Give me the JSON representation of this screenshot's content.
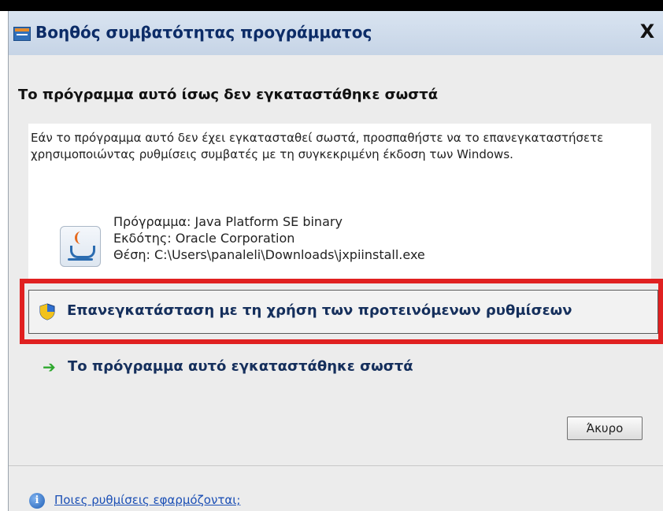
{
  "window": {
    "title": "Βοηθός συμβατότητας προγράμματος",
    "close_symbol": "X",
    "icon": "program-compatibility-icon"
  },
  "main": {
    "headline": "Το πρόγραμμα αυτό ίσως δεν εγκαταστάθηκε σωστά",
    "description": "Εάν το πρόγραμμα αυτό δεν έχει εγκατασταθεί σωστά, προσπαθήστε να το επανεγκαταστήσετε χρησιμοποιώντας ρυθμίσεις συμβατές με τη συγκεκριμένη έκδοση των Windows.",
    "program_icon": "java-icon",
    "program": "Πρόγραμμα: Java Platform SE binary",
    "publisher": "Εκδότης: Oracle Corporation",
    "location": "Θέση: C:\\Users\\panaleli\\Downloads\\jxpiinstall.exe"
  },
  "options": {
    "reinstall_label": "Επανεγκατάσταση με τη χρήση των προτεινόμενων ρυθμίσεων",
    "reinstall_icon": "uac-shield-icon",
    "installed_ok_label": "Το πρόγραμμα αυτό εγκαταστάθηκε σωστά",
    "installed_ok_icon": "green-arrow-icon"
  },
  "buttons": {
    "cancel": "Άκυρο"
  },
  "footer": {
    "help_link": "Ποιες ρυθμίσεις εφαρμόζονται;",
    "help_icon": "info-icon"
  },
  "colors": {
    "highlight": "#e02020",
    "title_text": "#0c2c67",
    "link": "#1b4fb5"
  }
}
